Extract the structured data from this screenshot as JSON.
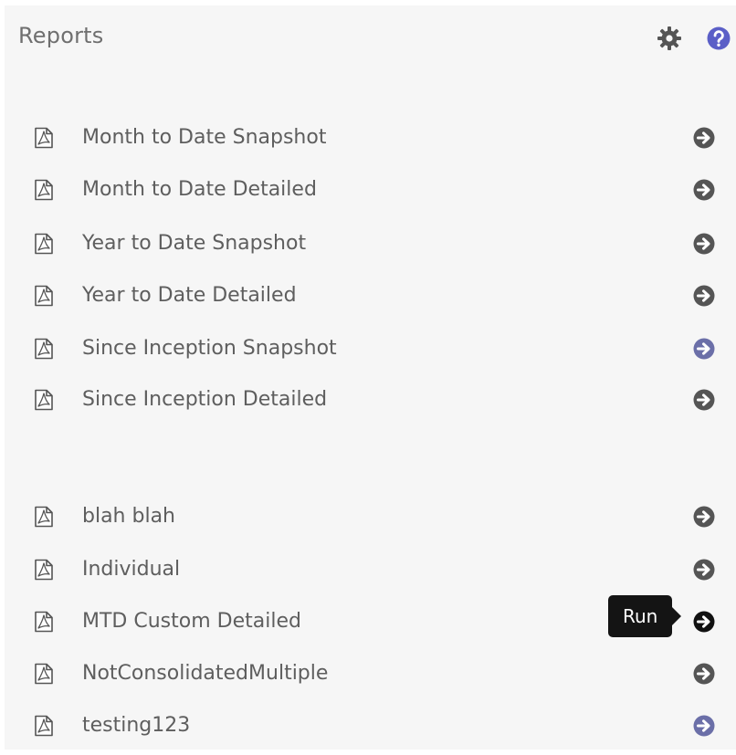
{
  "header": {
    "title": "Reports",
    "settings_icon": "gear-icon",
    "help_icon": "help-icon"
  },
  "groups": [
    {
      "items": [
        {
          "label": "Month to Date Snapshot"
        },
        {
          "label": "Month to Date Detailed"
        },
        {
          "label": "Year to Date Snapshot"
        },
        {
          "label": "Year to Date Detailed"
        },
        {
          "label": "Since Inception Snapshot"
        },
        {
          "label": "Since Inception Detailed"
        }
      ]
    },
    {
      "items": [
        {
          "label": "blah blah"
        },
        {
          "label": "Individual"
        },
        {
          "label": "MTD Custom Detailed"
        },
        {
          "label": "NotConsolidatedMultiple"
        },
        {
          "label": "testing123"
        }
      ]
    }
  ],
  "tooltip": {
    "text": "Run"
  },
  "icons": {
    "item_icon": "pdf-document-icon",
    "action_icon": "run-arrow-icon"
  },
  "colors": {
    "accent": "#5b5fc7",
    "icon_gray": "#555555",
    "text": "#5e5e5e"
  }
}
